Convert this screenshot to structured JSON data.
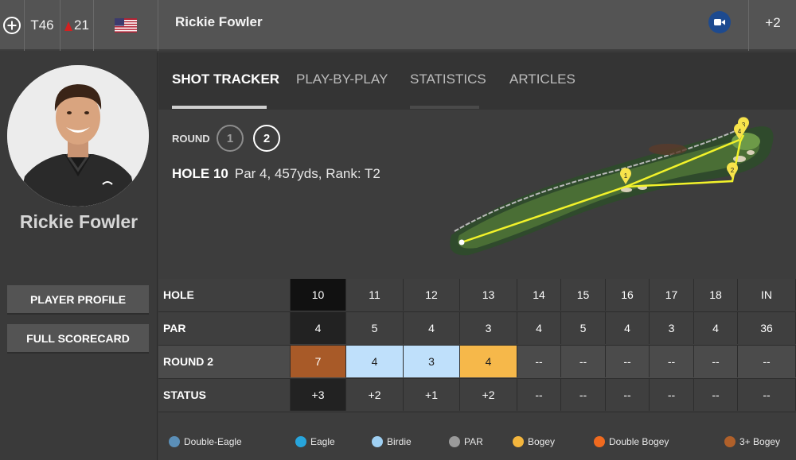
{
  "header": {
    "position": "T46",
    "movement": "21",
    "player_name": "Rickie Fowler",
    "more_count": "+2",
    "country_flag": "usa-flag-icon"
  },
  "sidebar": {
    "player_name": "Rickie Fowler",
    "profile_button": "PLAYER PROFILE",
    "scorecard_button": "FULL SCORECARD"
  },
  "tabs": [
    {
      "label": "SHOT TRACKER",
      "active": true
    },
    {
      "label": "PLAY-BY-PLAY",
      "active": false
    },
    {
      "label": "STATISTICS",
      "active": false
    },
    {
      "label": "ARTICLES",
      "active": false
    }
  ],
  "round": {
    "label": "ROUND",
    "options": [
      "1",
      "2"
    ],
    "selected": "2"
  },
  "hole": {
    "title": "HOLE 10",
    "details": "Par 4, 457yds, Rank: T2"
  },
  "shot_markers": [
    "1",
    "2",
    "3",
    "4"
  ],
  "scorecard": {
    "columns": [
      "HOLE",
      "10",
      "11",
      "12",
      "13",
      "14",
      "15",
      "16",
      "17",
      "18",
      "IN"
    ],
    "par": [
      "PAR",
      "4",
      "5",
      "4",
      "3",
      "4",
      "5",
      "4",
      "3",
      "4",
      "36"
    ],
    "round": [
      "ROUND 2",
      "7",
      "4",
      "3",
      "4",
      "--",
      "--",
      "--",
      "--",
      "--",
      "--"
    ],
    "status": [
      "STATUS",
      "+3",
      "+2",
      "+1",
      "+2",
      "--",
      "--",
      "--",
      "--",
      "--",
      "--"
    ],
    "round_colors": [
      "",
      "#a85a28",
      "#bfe0fb",
      "#bfe0fb",
      "#f6b84a",
      "",
      "",
      "",
      "",
      "",
      ""
    ]
  },
  "legend": [
    {
      "label": "Double-Eagle",
      "color": "#5b8fb8"
    },
    {
      "label": "Eagle",
      "color": "#27a5dc"
    },
    {
      "label": "Birdie",
      "color": "#9fd0f3"
    },
    {
      "label": "PAR",
      "color": "#9a9a9a"
    },
    {
      "label": "Bogey",
      "color": "#f4b63d"
    },
    {
      "label": "Double Bogey",
      "color": "#f06a1f"
    },
    {
      "label": "3+ Bogey",
      "color": "#b0602a"
    }
  ],
  "colors": {
    "accent_underline": "#cfcfcf",
    "video_button": "#1d4a8f",
    "shot_line": "#f2f22a"
  }
}
